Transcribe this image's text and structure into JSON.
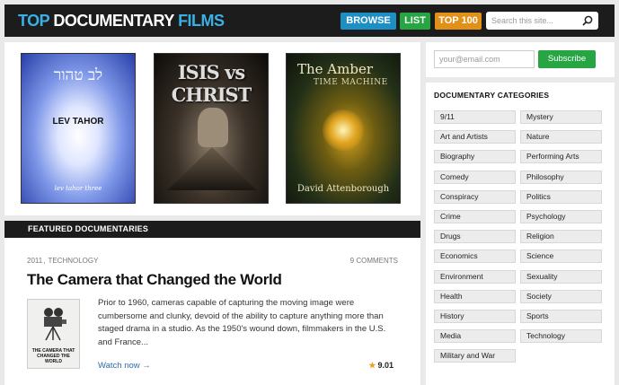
{
  "header": {
    "logo_top": "TOP",
    "logo_doc": "DOCUMENTARY",
    "logo_films": "FILMS",
    "nav": {
      "browse": "BROWSE",
      "list": "LIST",
      "top100": "TOP 100"
    },
    "search_placeholder": "Search this site..."
  },
  "posters": [
    {
      "heading": "לב טהור",
      "title": "LEV TAHOR",
      "subtitle": "lev tahor three"
    },
    {
      "title": "ISIS vs CHRIST"
    },
    {
      "title": "The Amber",
      "subtitle": "TIME MACHINE",
      "author": "David Attenborough"
    }
  ],
  "featured": {
    "heading": "FEATURED DOCUMENTARIES",
    "year": "2011",
    "separator": ",",
    "category": "TECHNOLOGY",
    "comments": "9 COMMENTS",
    "title": "The Camera that Changed the World",
    "thumb_text": "THE CAMERA THAT CHANGED THE WORLD",
    "description": "Prior to 1960, cameras capable of capturing the moving image were cumbersome and clunky, devoid of the ability to capture anything more than staged drama in a studio. As the 1950's wound down, filmmakers in the U.S. and France...",
    "watch_label": "Watch now →",
    "rating": "9.01"
  },
  "sidebar": {
    "email_placeholder": "your@email.com",
    "subscribe_label": "Subscribe",
    "categories_title": "DOCUMENTARY CATEGORIES",
    "categories": [
      "9/11",
      "Mystery",
      "Art and Artists",
      "Nature",
      "Biography",
      "Performing Arts",
      "Comedy",
      "Philosophy",
      "Conspiracy",
      "Politics",
      "Crime",
      "Psychology",
      "Drugs",
      "Religion",
      "Economics",
      "Science",
      "Environment",
      "Sexuality",
      "Health",
      "Society",
      "History",
      "Sports",
      "Media",
      "Technology",
      "Military and War"
    ]
  }
}
